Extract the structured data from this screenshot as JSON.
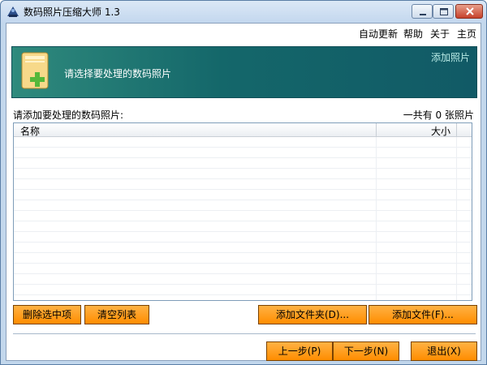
{
  "window": {
    "title": "数码照片压缩大师 1.3"
  },
  "menu": {
    "items": [
      "自动更新",
      "帮助",
      "关于",
      "主页"
    ]
  },
  "banner": {
    "instruction": "请选择要处理的数码照片",
    "add_photos_link": "添加照片"
  },
  "list": {
    "label": "请添加要处理的数码照片:",
    "count_text": "一共有 0 张照片",
    "columns": [
      "名称",
      "大小"
    ],
    "rows": []
  },
  "buttons": {
    "delete_selected": "删除选中项",
    "clear_list": "清空列表",
    "add_folder": "添加文件夹(D)...",
    "add_file": "添加文件(F)...",
    "prev": "上一步(P)",
    "next": "下一步(N)",
    "exit": "退出(X)"
  },
  "colors": {
    "banner_start": "#2f8a7d",
    "banner_end": "#115a66",
    "button_orange": "#ff9a12",
    "window_frame": "#c2d7ec"
  },
  "icons": {
    "app": "app-icon",
    "banner": "folder-add-icon",
    "minimize": "minimize-icon",
    "maximize": "maximize-icon",
    "close": "close-icon"
  }
}
